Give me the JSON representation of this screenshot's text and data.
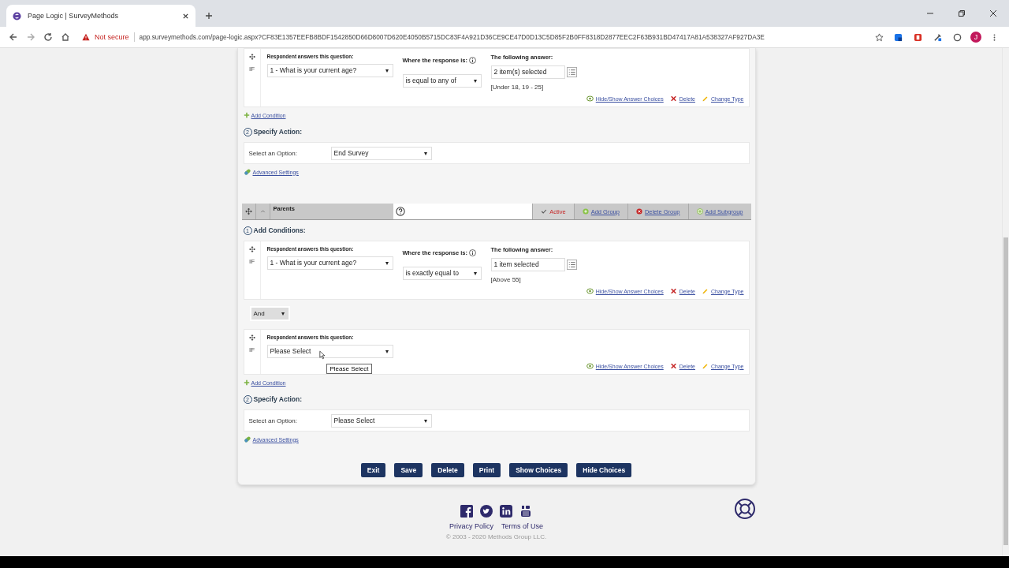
{
  "browser": {
    "tab_title": "Page Logic | SurveyMethods",
    "not_secure": "Not secure",
    "url": "app.surveymethods.com/page-logic.aspx?CF83E1357EEFB8BDF1542850D66D8007D620E4050B5715DC83F4A921D36CE9CE47D0D13C5D85F2B0FF8318D2877EEC2F63B931BD47417A81A538327AF927DA3E",
    "profile_initial": "J"
  },
  "groups": [
    {
      "conditions": [
        {
          "question_label": "Respondent answers this question:",
          "operator_label": "Where the response is:",
          "answer_label": "The following answer:",
          "if_label": "IF",
          "question": "1 - What is your current age?",
          "operator": "is equal to any of",
          "answer": "2 item(s) selected",
          "answer_values": "[Under 18, 19 - 25]",
          "links": [
            "Hide/Show Answer Choices",
            "Delete",
            "Change Type"
          ]
        }
      ],
      "add_condition": "Add Condition",
      "action": {
        "step": "2",
        "heading": "Specify Action:",
        "label": "Select an Option:",
        "value": "End Survey"
      },
      "advanced_settings": "Advanced Settings"
    },
    {
      "header": {
        "name": "Parents",
        "active": {
          "label": "Active",
          "checked": true
        },
        "buttons": [
          {
            "kind": "add",
            "label": "Add Group"
          },
          {
            "kind": "delete",
            "label": "Delete Group"
          },
          {
            "kind": "add-sub",
            "label": "Add Subgroup"
          }
        ]
      },
      "conditions_heading": {
        "step": "1",
        "text": "Add Conditions:"
      },
      "conditions": [
        {
          "question_label": "Respondent answers this question:",
          "operator_label": "Where the response is:",
          "answer_label": "The following answer:",
          "if_label": "IF",
          "question": "1 - What is your current age?",
          "operator": "is exactly equal to",
          "answer": "1 item selected",
          "answer_values": "[Above 55]",
          "links": [
            "Hide/Show Answer Choices",
            "Delete",
            "Change Type"
          ]
        },
        {
          "conjunction": "And",
          "question_label": "Respondent answers this question:",
          "if_label": "IF",
          "question": "Please Select",
          "tooltip": "Please Select",
          "links": [
            "Hide/Show Answer Choices",
            "Delete",
            "Change Type"
          ]
        }
      ],
      "add_condition": "Add Condition",
      "action": {
        "step": "2",
        "heading": "Specify Action:",
        "label": "Select an Option:",
        "value": "Please Select"
      },
      "advanced_settings": "Advanced Settings"
    }
  ],
  "buttons": [
    "Exit",
    "Save",
    "Delete",
    "Print",
    "Show Choices",
    "Hide Choices"
  ],
  "footer": {
    "links": [
      "Privacy Policy",
      "Terms of Use"
    ],
    "copyright": "© 2003 - 2020 Methods Group LLC."
  }
}
